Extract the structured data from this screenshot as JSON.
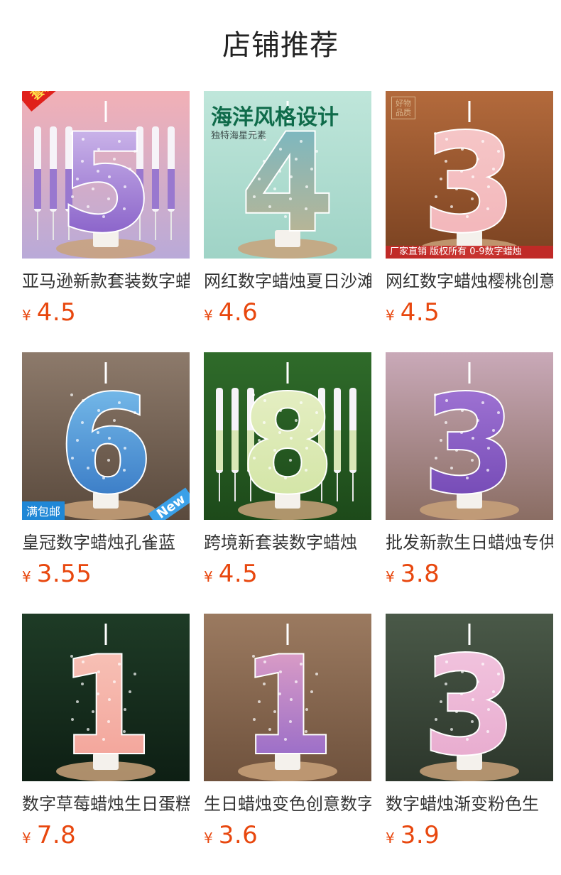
{
  "header": {
    "title": "店铺推荐"
  },
  "currency_symbol": "¥",
  "products": [
    {
      "name": "亚马逊新款套装数字蜡烛",
      "price": "4.5",
      "image_icon": "number-5-candle-set-image",
      "badge": "套装",
      "digit": "5",
      "bg1": "#f2b0b6",
      "bg2": "#b9aad8",
      "fill1": "#d9c6f0",
      "fill2": "#7a4fc2",
      "candles": true
    },
    {
      "name": "网红数字蜡烛夏日沙滩",
      "price": "4.6",
      "image_icon": "number-4-ocean-candle-image",
      "banner_title": "海洋风格设计",
      "banner_sub": "独特海星元素",
      "digit": "4",
      "bg1": "#bfe6da",
      "bg2": "#9fd3c6",
      "fill1": "#6fb8c9",
      "fill2": "#c8b48a"
    },
    {
      "name": "网红数字蜡烛樱桃创意",
      "price": "4.5",
      "image_icon": "number-3-cherry-candle-image",
      "stamp": "好物品质",
      "footer_text": "厂家直销  版权所有  0-9数字蜡烛",
      "digit": "3",
      "bg1": "#b36a3c",
      "bg2": "#7a4221",
      "fill1": "#f6c9c9",
      "fill2": "#f2b3b8"
    },
    {
      "name": "皇冠数字蜡烛孔雀蓝",
      "price": "3.55",
      "image_icon": "number-6-crown-candle-image",
      "corner_label": "满包邮",
      "corner_tag": "New",
      "digit": "6",
      "bg1": "#8d7a6b",
      "bg2": "#5a4a3d",
      "fill1": "#7fc4ef",
      "fill2": "#2e6fbf"
    },
    {
      "name": "跨境新套装数字蜡烛",
      "price": "4.5",
      "image_icon": "number-8-candle-set-image",
      "digit": "8",
      "bg1": "#2f6b2a",
      "bg2": "#1d4a1a",
      "fill1": "#e8f0c8",
      "fill2": "#cfe3a0",
      "candles": true
    },
    {
      "name": "批发新款生日蜡烛专供",
      "price": "3.8",
      "image_icon": "number-3-purple-crown-candle-image",
      "digit": "3",
      "bg1": "#c9a9b8",
      "bg2": "#8a6d63",
      "fill1": "#a67ad8",
      "fill2": "#6c42b0"
    },
    {
      "name": "数字草莓蜡烛生日蛋糕",
      "price": "7.8",
      "image_icon": "number-1-strawberry-candle-image",
      "digit": "1",
      "bg1": "#1e3b26",
      "bg2": "#0e1f14",
      "fill1": "#f8c6bb",
      "fill2": "#f29f95"
    },
    {
      "name": "生日蜡烛变色创意数字",
      "price": "3.6",
      "image_icon": "number-1-purple-crown-candle-image",
      "digit": "1",
      "bg1": "#9b7a60",
      "bg2": "#6f523d",
      "fill1": "#e8a6c6",
      "fill2": "#8a62c8"
    },
    {
      "name": "数字蜡烛渐变粉色生",
      "price": "3.9",
      "image_icon": "number-3-pink-shell-candle-image",
      "digit": "3",
      "bg1": "#4a5948",
      "bg2": "#2c362b",
      "fill1": "#f3c7e0",
      "fill2": "#e6a7cc"
    }
  ]
}
